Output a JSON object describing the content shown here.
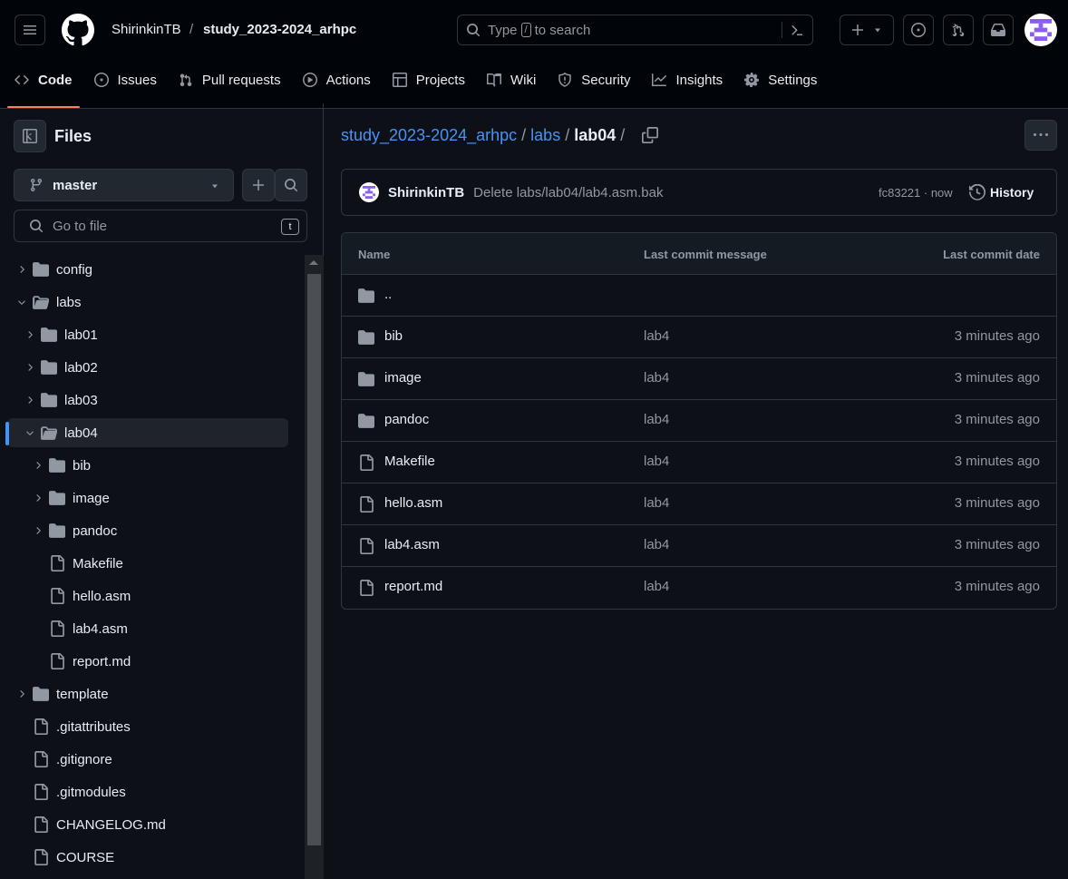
{
  "header": {
    "owner": "ShirinkinTB",
    "separator": "/",
    "repo": "study_2023-2024_arhpc",
    "search": {
      "prefix": "Type",
      "key": "/",
      "suffix": "to search"
    }
  },
  "nav": {
    "tabs": [
      {
        "label": "Code",
        "icon": "code-icon",
        "active": true
      },
      {
        "label": "Issues",
        "icon": "issue-icon"
      },
      {
        "label": "Pull requests",
        "icon": "pull-request-icon"
      },
      {
        "label": "Actions",
        "icon": "play-icon"
      },
      {
        "label": "Projects",
        "icon": "table-icon"
      },
      {
        "label": "Wiki",
        "icon": "book-icon"
      },
      {
        "label": "Security",
        "icon": "shield-icon"
      },
      {
        "label": "Insights",
        "icon": "graph-icon"
      },
      {
        "label": "Settings",
        "icon": "gear-icon"
      }
    ]
  },
  "sidebar": {
    "title": "Files",
    "branch": "master",
    "goto_placeholder": "Go to file",
    "goto_key": "t",
    "tree": [
      {
        "label": "config",
        "type": "folder",
        "expanded": false,
        "depth": 0
      },
      {
        "label": "labs",
        "type": "folder",
        "expanded": true,
        "depth": 0
      },
      {
        "label": "lab01",
        "type": "folder",
        "expanded": false,
        "depth": 1
      },
      {
        "label": "lab02",
        "type": "folder",
        "expanded": false,
        "depth": 1
      },
      {
        "label": "lab03",
        "type": "folder",
        "expanded": false,
        "depth": 1
      },
      {
        "label": "lab04",
        "type": "folder",
        "expanded": true,
        "depth": 1,
        "selected": true
      },
      {
        "label": "bib",
        "type": "folder",
        "expanded": false,
        "depth": 2
      },
      {
        "label": "image",
        "type": "folder",
        "expanded": false,
        "depth": 2
      },
      {
        "label": "pandoc",
        "type": "folder",
        "expanded": false,
        "depth": 2
      },
      {
        "label": "Makefile",
        "type": "file",
        "depth": 2
      },
      {
        "label": "hello.asm",
        "type": "file",
        "depth": 2
      },
      {
        "label": "lab4.asm",
        "type": "file",
        "depth": 2
      },
      {
        "label": "report.md",
        "type": "file",
        "depth": 2
      },
      {
        "label": "template",
        "type": "folder",
        "expanded": false,
        "depth": 0
      },
      {
        "label": ".gitattributes",
        "type": "file",
        "depth": 0
      },
      {
        "label": ".gitignore",
        "type": "file",
        "depth": 0
      },
      {
        "label": ".gitmodules",
        "type": "file",
        "depth": 0
      },
      {
        "label": "CHANGELOG.md",
        "type": "file",
        "depth": 0
      },
      {
        "label": "COURSE",
        "type": "file",
        "depth": 0
      }
    ]
  },
  "breadcrumb": {
    "repo": "study_2023-2024_arhpc",
    "labs": "labs",
    "current": "lab04",
    "sep": "/"
  },
  "commit": {
    "author": "ShirinkinTB",
    "message": "Delete labs/lab04/lab4.asm.bak",
    "sha_time": "fc83221 · now",
    "history": "History"
  },
  "table": {
    "headers": {
      "name": "Name",
      "message": "Last commit message",
      "date": "Last commit date"
    },
    "rows": [
      {
        "name": "..",
        "type": "folder",
        "message": "",
        "date": ""
      },
      {
        "name": "bib",
        "type": "folder",
        "message": "lab4",
        "date": "3 minutes ago"
      },
      {
        "name": "image",
        "type": "folder",
        "message": "lab4",
        "date": "3 minutes ago"
      },
      {
        "name": "pandoc",
        "type": "folder",
        "message": "lab4",
        "date": "3 minutes ago"
      },
      {
        "name": "Makefile",
        "type": "file",
        "message": "lab4",
        "date": "3 minutes ago"
      },
      {
        "name": "hello.asm",
        "type": "file",
        "message": "lab4",
        "date": "3 minutes ago"
      },
      {
        "name": "lab4.asm",
        "type": "file",
        "message": "lab4",
        "date": "3 minutes ago"
      },
      {
        "name": "report.md",
        "type": "file",
        "message": "lab4",
        "date": "3 minutes ago"
      }
    ]
  },
  "colors": {
    "accent_link": "#4493f8",
    "tab_underline": "#f78166",
    "background": "#0d1117"
  }
}
